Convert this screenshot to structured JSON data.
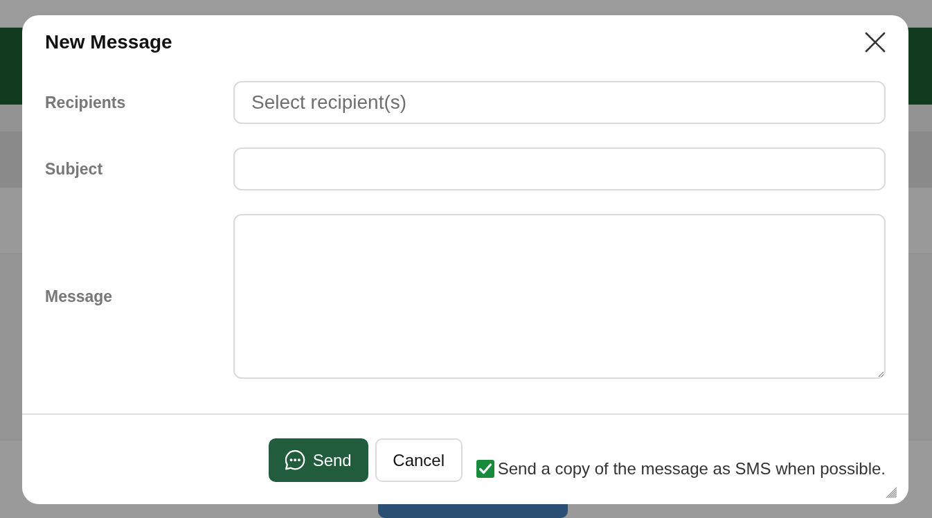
{
  "dialog": {
    "title": "New Message"
  },
  "fields": [
    {
      "kind": "select",
      "label": "Recipients",
      "placeholder": "Select recipient(s)"
    },
    {
      "kind": "text",
      "label": "Subject"
    },
    {
      "kind": "textarea",
      "label": "Message"
    }
  ],
  "footer": {
    "buttons": [
      {
        "kind": "primary",
        "label": "Send"
      },
      {
        "kind": "secondary",
        "label": "Cancel"
      }
    ],
    "sms_copy": {
      "label": "Send a copy of the message as SMS when possible.",
      "checked": true
    }
  }
}
